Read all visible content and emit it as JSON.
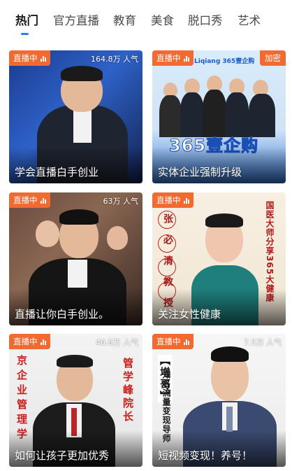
{
  "tabs": [
    {
      "label": "热门",
      "active": true
    },
    {
      "label": "官方直播",
      "active": false
    },
    {
      "label": "教育",
      "active": false
    },
    {
      "label": "美食",
      "active": false
    },
    {
      "label": "脱口秀",
      "active": false
    },
    {
      "label": "艺术",
      "active": false
    }
  ],
  "colors": {
    "accent": "#2d7cf6",
    "live_tag": "#f26a30"
  },
  "cards": [
    {
      "live_label": "直播中",
      "viewers": "164.8万 人气",
      "title": "学会直播白手创业"
    },
    {
      "live_label": "直播中",
      "lock_label": "加密",
      "title": "实体企业强制升级",
      "poster_text": "365壹企购",
      "poster_logo": "Liqiang 365壹企购"
    },
    {
      "live_label": "直播中",
      "viewers": "63万 人气",
      "title": "直播让你白手创业。"
    },
    {
      "live_label": "直播中",
      "title": "关注女性健康",
      "poster_name": "张必清教授",
      "poster_caption": "国医大师分享365大健康"
    },
    {
      "live_label": "直播中",
      "viewers": "40.6万 人气",
      "title": "如何让孩子更加优秀",
      "poster_left": "京企业管理学",
      "poster_right": "管学峰院长"
    },
    {
      "live_label": "直播中",
      "viewers": "7.5万 人气",
      "title": "短视频变现！养号！",
      "poster_bracket": "【增哥】",
      "poster_caption": "知名流量变现导师"
    }
  ]
}
